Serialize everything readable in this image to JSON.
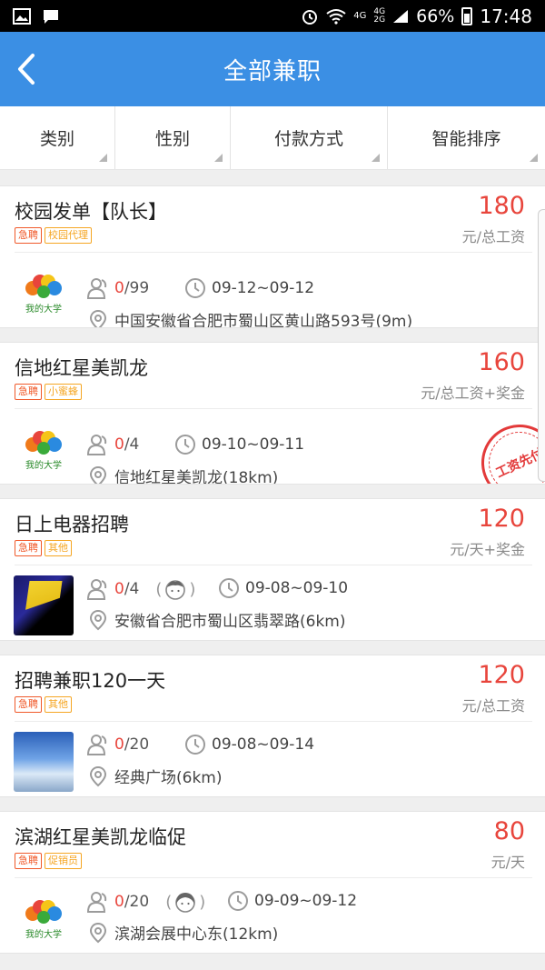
{
  "status_bar": {
    "network_top": "4G",
    "network_dual_a": "4G",
    "network_dual_b": "2G",
    "battery": "66%",
    "time": "17:48"
  },
  "nav": {
    "title": "全部兼职"
  },
  "filters": [
    "类别",
    "性别",
    "付款方式",
    "智能排序"
  ],
  "jobs": [
    {
      "title": "校园发单【队长】",
      "tags": [
        "急聘",
        "校园代理"
      ],
      "price": "180",
      "unit": "元/总工资",
      "logo": "我的大学",
      "hired": "0",
      "total": "/99",
      "date": "09-12~09-12",
      "location": "中国安徽省合肥市蜀山区黄山路593号(9m)"
    },
    {
      "title": "信地红星美凯龙",
      "tags": [
        "急聘",
        "小蜜蜂"
      ],
      "price": "160",
      "unit": "元/总工资+奖金",
      "logo": "我的大学",
      "hired": "0",
      "total": "/4",
      "date": "09-10~09-11",
      "location": "信地红星美凯龙(18km)",
      "stamp": "工资先付"
    },
    {
      "title": "日上电器招聘",
      "tags": [
        "急聘",
        "其他"
      ],
      "price": "120",
      "unit": "元/天+奖金",
      "hired": "0",
      "total": "/4",
      "date": "09-08~09-10",
      "location": "安徽省合肥市蜀山区翡翠路(6km)",
      "gender_open": "(",
      "gender_close": ")"
    },
    {
      "title": "招聘兼职120一天",
      "tags": [
        "急聘",
        "其他"
      ],
      "price": "120",
      "unit": "元/总工资",
      "hired": "0",
      "total": "/20",
      "date": "09-08~09-14",
      "location": "经典广场(6km)"
    },
    {
      "title": "滨湖红星美凯龙临促",
      "tags": [
        "急聘",
        "促销员"
      ],
      "price": "80",
      "unit": "元/天",
      "logo": "我的大学",
      "hired": "0",
      "total": "/20",
      "date": "09-09~09-12",
      "location": "滨湖会展中心东(12km)",
      "gender_open": "(",
      "gender_close": ")"
    }
  ],
  "colors": {
    "primary": "#3b8fe4",
    "price": "#e8453c",
    "urgent": "#f0592a",
    "tag": "#f5a623"
  }
}
